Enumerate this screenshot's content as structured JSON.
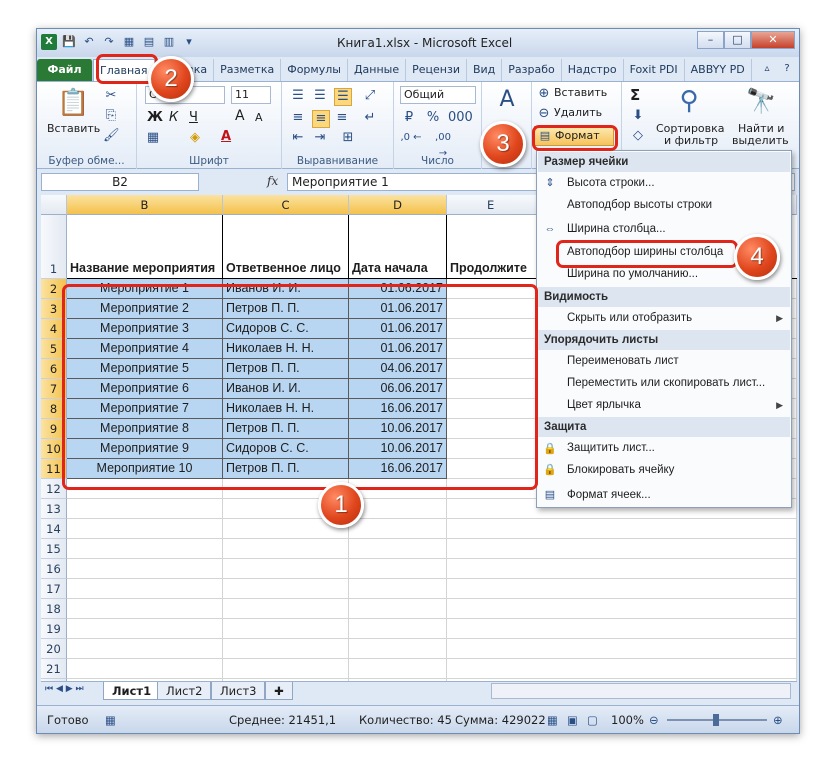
{
  "window": {
    "title": "Книга1.xlsx - Microsoft Excel",
    "app_icon": "X",
    "controls": [
      "–",
      "□",
      "✕"
    ]
  },
  "tabs": [
    "Файл",
    "Главная",
    "Вставка",
    "Разметка",
    "Формулы",
    "Данные",
    "Рецензи",
    "Вид",
    "Разрабо",
    "Надстро",
    "Foxit PDI",
    "ABBYY PD"
  ],
  "ribbon": {
    "clipboard": {
      "paste": "Вставить",
      "label": "Буфер обме..."
    },
    "font": {
      "name": "Calibri",
      "name_shown": "Ca",
      "size": "11",
      "bold": "Ж",
      "italic": "К",
      "underline": "Ч",
      "grow": "A",
      "shrink": "A",
      "color": "A",
      "label": "Шрифт"
    },
    "alignment": {
      "label": "Выравнивание"
    },
    "number": {
      "format": "Общий",
      "label": "Число"
    },
    "styles": {
      "label": "Стили"
    },
    "cells": {
      "insert": "Вставить",
      "delete": "Удалить",
      "format": "Формат"
    },
    "editing": {
      "sort": "Сортировка",
      "sort2": "и фильтр",
      "find": "Найти и",
      "find2": "выделить",
      "sum": "Σ"
    }
  },
  "formula_bar": {
    "name_box": "B2",
    "fx": "fx",
    "value": "Мероприятие 1"
  },
  "columns": [
    "B",
    "C",
    "D",
    "E"
  ],
  "header_row": [
    "Название мероприятия",
    "Ответвенное лицо",
    "Дата начала",
    "Продолжите"
  ],
  "rows": [
    [
      "Мероприятие 1",
      "Иванов И. И.",
      "01.06.2017"
    ],
    [
      "Мероприятие 2",
      "Петров П. П.",
      "01.06.2017"
    ],
    [
      "Мероприятие 3",
      "Сидоров С. С.",
      "01.06.2017"
    ],
    [
      "Мероприятие 4",
      "Николаев Н. Н.",
      "01.06.2017"
    ],
    [
      "Мероприятие 5",
      "Петров П. П.",
      "04.06.2017"
    ],
    [
      "Мероприятие 6",
      "Иванов И. И.",
      "06.06.2017"
    ],
    [
      "Мероприятие 7",
      "Николаев Н. Н.",
      "16.06.2017"
    ],
    [
      "Мероприятие 8",
      "Петров П. П.",
      "10.06.2017"
    ],
    [
      "Мероприятие 9",
      "Сидоров С. С.",
      "10.06.2017"
    ],
    [
      "Мероприятие 10",
      "Петров П. П.",
      "16.06.2017"
    ]
  ],
  "row_numbers": [
    "1",
    "2",
    "3",
    "4",
    "5",
    "6",
    "7",
    "8",
    "9",
    "10",
    "11",
    "12",
    "13",
    "14",
    "15",
    "16",
    "17",
    "18",
    "19",
    "20",
    "21",
    "22"
  ],
  "menu": {
    "sections": [
      "Размер ячейки",
      "Видимость",
      "Упорядочить листы",
      "Защита"
    ],
    "items": [
      "Высота строки...",
      "Автоподбор высоты строки",
      "Ширина столбца...",
      "Автоподбор ширины столбца",
      "Ширина по умолчанию...",
      "Скрыть или отобразить",
      "Переименовать лист",
      "Переместить или скопировать лист...",
      "Цвет ярлычка",
      "Защитить лист...",
      "Блокировать ячейку",
      "Формат ячеек..."
    ]
  },
  "sheets": [
    "Лист1",
    "Лист2",
    "Лист3"
  ],
  "status": {
    "ready": "Готово",
    "average": "Среднее: 21451,1",
    "count": "Количество: 45",
    "sum": "Сумма: 429022",
    "zoom": "100%"
  },
  "callouts": [
    "1",
    "2",
    "3",
    "4"
  ],
  "colors": {
    "selection": "#b8d6f2",
    "callout": "#e0461d",
    "file_tab": "#2a7a36",
    "highlight": "#e0261a"
  }
}
